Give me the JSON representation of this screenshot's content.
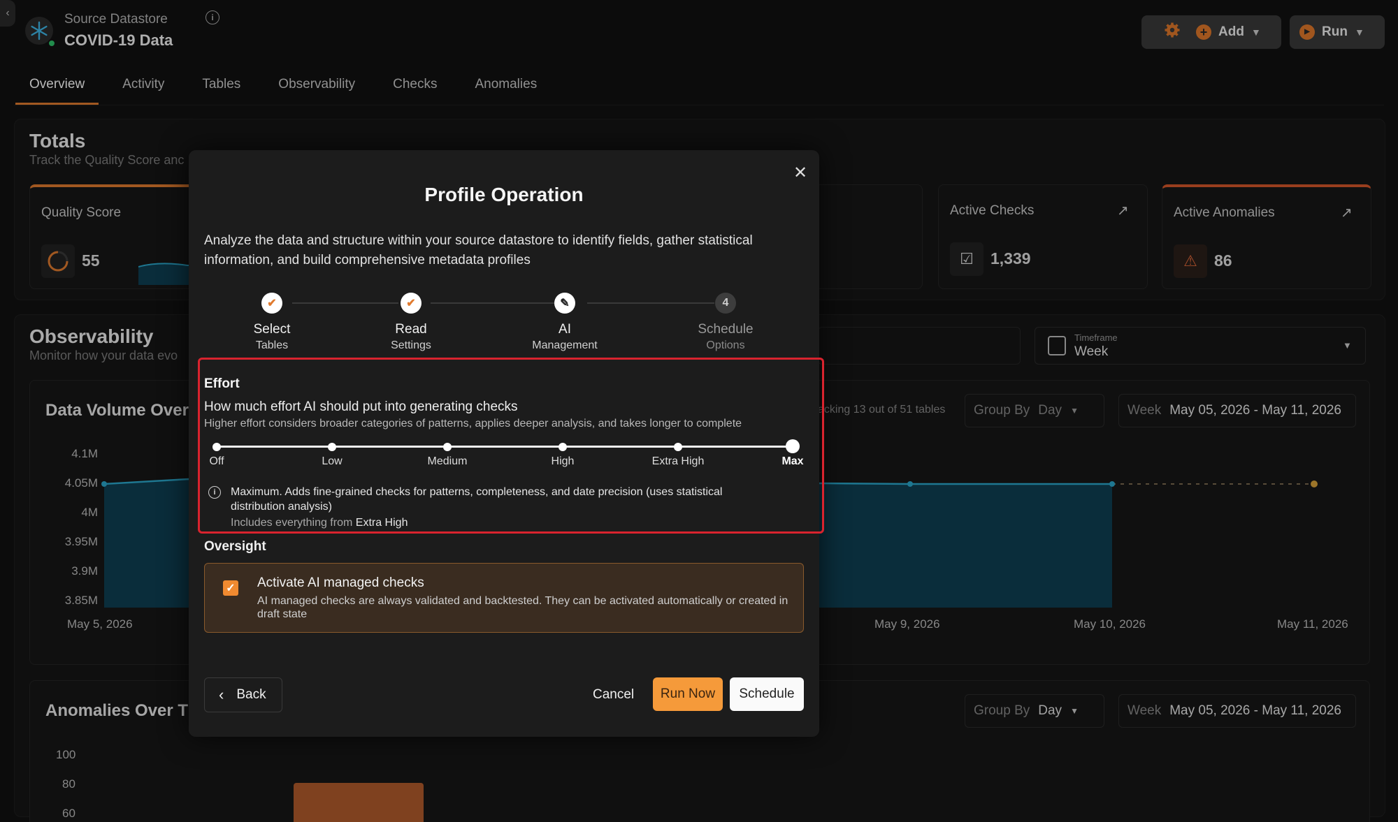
{
  "header": {
    "datastore_label": "Source Datastore",
    "datastore_name": "COVID-19 Data",
    "add_label": "Add",
    "run_label": "Run"
  },
  "tabs": [
    {
      "label": "Overview",
      "active": true
    },
    {
      "label": "Activity"
    },
    {
      "label": "Tables"
    },
    {
      "label": "Observability"
    },
    {
      "label": "Checks"
    },
    {
      "label": "Anomalies"
    }
  ],
  "totals": {
    "title": "Totals",
    "subtitle": "Track the Quality Score anc",
    "quality_score_label": "Quality Score",
    "quality_score_value": "55",
    "active_checks_label": "Active Checks",
    "active_checks_value": "1,339",
    "active_anomalies_label": "Active Anomalies",
    "active_anomalies_value": "86"
  },
  "observability": {
    "title": "Observability",
    "subtitle": "Monitor how your data evo",
    "timeframe_label": "Timeframe",
    "timeframe_value": "Week"
  },
  "data_volume": {
    "title": "Data Volume Over",
    "tracking_text": "acking 13 out of 51 tables",
    "group_by_label": "Group By",
    "group_by_value": "Day",
    "week_label": "Week",
    "date_range": "May 05, 2026 - May 11, 2026",
    "y_ticks": [
      "4.1M",
      "4.05M",
      "4M",
      "3.95M",
      "3.9M",
      "3.85M"
    ],
    "x_ticks": [
      "May 5, 2026",
      "May 9, 2026",
      "May 10, 2026",
      "May 11, 2026"
    ]
  },
  "anomalies_over_time": {
    "title": "Anomalies Over Ti",
    "group_by_label": "Group By",
    "group_by_value": "Day",
    "week_label": "Week",
    "date_range": "May 05, 2026 - May 11, 2026",
    "y_ticks": [
      "100",
      "80",
      "60"
    ]
  },
  "modal": {
    "title": "Profile Operation",
    "close_glyph": "✕",
    "description": "Analyze the data and structure within your source datastore to identify fields, gather statistical information, and build comprehensive metadata profiles",
    "steps": [
      {
        "title": "Select",
        "subtitle": "Tables",
        "state": "done"
      },
      {
        "title": "Read",
        "subtitle": "Settings",
        "state": "done"
      },
      {
        "title": "AI",
        "subtitle": "Management",
        "state": "current"
      },
      {
        "title": "Schedule",
        "subtitle": "Options",
        "state": "todo",
        "number": "4"
      }
    ],
    "effort": {
      "heading": "Effort",
      "question": "How much effort AI should put into generating checks",
      "hint": "Higher effort considers broader categories of patterns, applies deeper analysis, and takes longer to complete",
      "levels": [
        "Off",
        "Low",
        "Medium",
        "High",
        "Extra High",
        "Max"
      ],
      "selected": "Max",
      "selected_description": "Maximum. Adds fine-grained checks for patterns, completeness, and date precision (uses statistical distribution analysis)",
      "includes_prefix": "Includes everything from",
      "includes_level": "Extra High"
    },
    "oversight": {
      "heading": "Oversight",
      "checkbox_label": "Activate AI managed checks",
      "checkbox_checked": true,
      "checkbox_description": "AI managed checks are always validated and backtested. They can be activated automatically or created in draft state"
    },
    "buttons": {
      "back": "Back",
      "cancel": "Cancel",
      "run_now": "Run Now",
      "schedule": "Schedule"
    }
  },
  "colors": {
    "accent": "#f59a3a",
    "highlight_border": "#d9232e",
    "chart_fill": "#0f3f52",
    "chart_line": "#2aa6c9"
  }
}
